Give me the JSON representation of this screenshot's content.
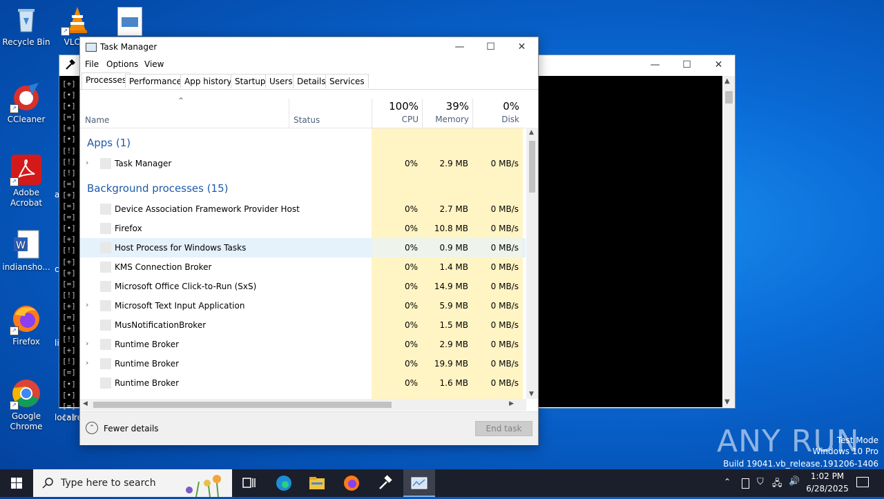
{
  "desktop": {
    "icons": [
      {
        "label": "Recycle Bin"
      },
      {
        "label": "VLC m"
      },
      {
        "label": "CCleaner"
      },
      {
        "label": "Adobe Acrobat"
      },
      {
        "label": "indiansho..."
      },
      {
        "label": "Firefox"
      },
      {
        "label": "Google Chrome"
      },
      {
        "label": "localre"
      }
    ],
    "partial_labels": [
      "a",
      "c",
      "li"
    ]
  },
  "console": {
    "lines": [
      "[+]",
      "[•]",
      "[•]",
      "[=]",
      "[+]",
      "[•]",
      "[!]",
      "[!]",
      "[!]",
      "[=]",
      "[+]",
      "[=]",
      "[=]",
      "[•]",
      "[+]",
      "[!]",
      "[+]",
      "[+]",
      "[=]",
      "[!]",
      "[+]",
      "[=]",
      "[+]",
      "[!]",
      "[+]",
      "[!]",
      "[=]",
      "[•]",
      "[•]",
      "[=]",
      "[•]"
    ]
  },
  "taskmanager": {
    "title": "Task Manager",
    "menu": [
      "File",
      "Options",
      "View"
    ],
    "tabs": [
      "Processes",
      "Performance",
      "App history",
      "Startup",
      "Users",
      "Details",
      "Services"
    ],
    "columns": {
      "name": "Name",
      "status": "Status",
      "cpu": {
        "pct": "100%",
        "label": "CPU"
      },
      "memory": {
        "pct": "39%",
        "label": "Memory"
      },
      "disk": {
        "pct": "0%",
        "label": "Disk"
      }
    },
    "apps_header": "Apps (1)",
    "apps": [
      {
        "name": "Task Manager",
        "cpu": "0%",
        "mem": "2.9 MB",
        "disk": "0 MB/s",
        "expandable": true
      }
    ],
    "bg_header": "Background processes (15)",
    "background": [
      {
        "name": "Device Association Framework Provider Host",
        "cpu": "0%",
        "mem": "2.7 MB",
        "disk": "0 MB/s",
        "expandable": false
      },
      {
        "name": "Firefox",
        "cpu": "0%",
        "mem": "10.8 MB",
        "disk": "0 MB/s",
        "expandable": false
      },
      {
        "name": "Host Process for Windows Tasks",
        "cpu": "0%",
        "mem": "0.9 MB",
        "disk": "0 MB/s",
        "expandable": false
      },
      {
        "name": "KMS Connection Broker",
        "cpu": "0%",
        "mem": "1.4 MB",
        "disk": "0 MB/s",
        "expandable": false
      },
      {
        "name": "Microsoft Office Click-to-Run (SxS)",
        "cpu": "0%",
        "mem": "14.9 MB",
        "disk": "0 MB/s",
        "expandable": false
      },
      {
        "name": "Microsoft Text Input Application",
        "cpu": "0%",
        "mem": "5.9 MB",
        "disk": "0 MB/s",
        "expandable": true
      },
      {
        "name": "MusNotificationBroker",
        "cpu": "0%",
        "mem": "1.5 MB",
        "disk": "0 MB/s",
        "expandable": false
      },
      {
        "name": "Runtime Broker",
        "cpu": "0%",
        "mem": "2.9 MB",
        "disk": "0 MB/s",
        "expandable": true
      },
      {
        "name": "Runtime Broker",
        "cpu": "0%",
        "mem": "19.9 MB",
        "disk": "0 MB/s",
        "expandable": true
      },
      {
        "name": "Runtime Broker",
        "cpu": "0%",
        "mem": "1.6 MB",
        "disk": "0 MB/s",
        "expandable": false
      }
    ],
    "footer": {
      "fewer": "Fewer details",
      "end_task": "End task"
    }
  },
  "taskbar": {
    "search_placeholder": "Type here to search",
    "time": "1:02 PM",
    "date": "6/28/2025"
  },
  "watermark": {
    "line1": "Test Mode",
    "line2": "Windows 10 Pro",
    "line3": "Build 19041.vb_release.191206-1406",
    "brand": "ANY RUN"
  },
  "colors": {
    "accent_blue": "#1e5aa8",
    "cpu_highlight": "#fff4c4",
    "mem_highlight": "#fff4c4",
    "selected_row": "#e5f1fb"
  }
}
